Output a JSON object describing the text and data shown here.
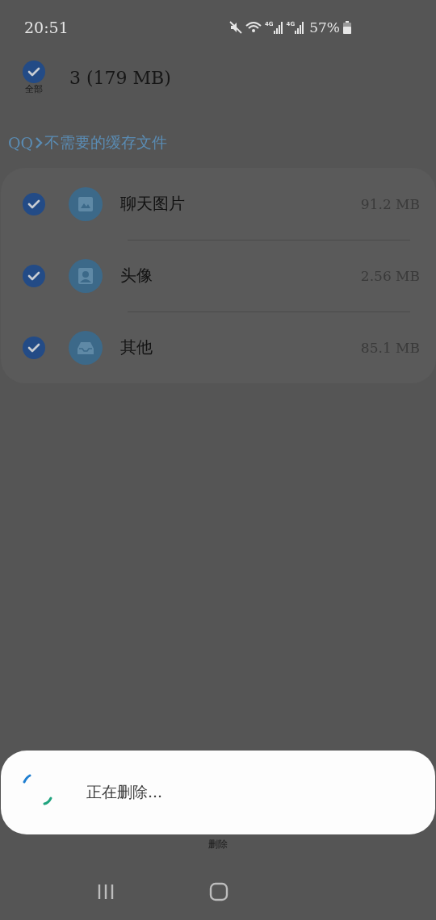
{
  "status_bar": {
    "time": "20:51",
    "signals": [
      {
        "label": "4G"
      },
      {
        "label": "4G"
      }
    ],
    "battery": "57%"
  },
  "header": {
    "select_all": {
      "label": "全部",
      "checked": true
    },
    "summary": "3 (179 MB)"
  },
  "breadcrumb": [
    "QQ",
    "不需要的缓存文件"
  ],
  "items": [
    {
      "kind": "image",
      "name": "聊天图片",
      "size": "91.2 MB",
      "checked": true
    },
    {
      "kind": "avatar",
      "name": "头像",
      "size": "2.56 MB",
      "checked": true
    },
    {
      "kind": "other",
      "name": "其他",
      "size": "85.1 MB",
      "checked": true
    }
  ],
  "bottom_action": "删除",
  "dialog": {
    "message": "正在删除..."
  }
}
